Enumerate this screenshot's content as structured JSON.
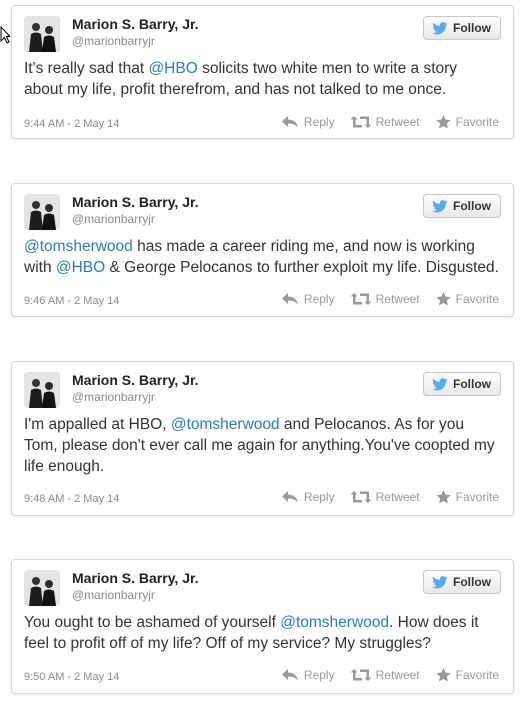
{
  "tweets": [
    {
      "name": "Marion S. Barry, Jr.",
      "handle": "@marionbarryjr",
      "follow_label": "Follow",
      "text": [
        {
          "t": "It's really sad that "
        },
        {
          "t": "@HBO",
          "mention": true
        },
        {
          "t": " solicits two white men to write a story about my life, profit therefrom, and has not talked to me once."
        }
      ],
      "time": "9:44 AM - 2 May 14",
      "reply_label": "Reply",
      "retweet_label": "Retweet",
      "favorite_label": "Favorite"
    },
    {
      "name": "Marion S. Barry, Jr.",
      "handle": "@marionbarryjr",
      "follow_label": "Follow",
      "text": [
        {
          "t": "@tomsherwood",
          "mention": true
        },
        {
          "t": " has made a career riding me, and now is working with "
        },
        {
          "t": "@HBO",
          "mention": true
        },
        {
          "t": " & George Pelocanos to further exploit my life. Disgusted."
        }
      ],
      "time": "9:46 AM - 2 May 14",
      "reply_label": "Reply",
      "retweet_label": "Retweet",
      "favorite_label": "Favorite"
    },
    {
      "name": "Marion S. Barry, Jr.",
      "handle": "@marionbarryjr",
      "follow_label": "Follow",
      "text": [
        {
          "t": "I'm appalled at HBO, "
        },
        {
          "t": "@tomsherwood",
          "mention": true
        },
        {
          "t": " and Pelocanos. As for you Tom, please don't ever call me again for anything.You've coopted my life enough."
        }
      ],
      "time": "9:48 AM - 2 May 14",
      "reply_label": "Reply",
      "retweet_label": "Retweet",
      "favorite_label": "Favorite"
    },
    {
      "name": "Marion S. Barry, Jr.",
      "handle": "@marionbarryjr",
      "follow_label": "Follow",
      "text": [
        {
          "t": "You ought to be ashamed of yourself "
        },
        {
          "t": "@tomsherwood",
          "mention": true
        },
        {
          "t": ". How does it feel to profit off of my life? Off of my service? My struggles?"
        }
      ],
      "time": "9:50 AM - 2 May 14",
      "reply_label": "Reply",
      "retweet_label": "Retweet",
      "favorite_label": "Favorite"
    }
  ],
  "colors": {
    "mention": "#2b7bb9",
    "bird": "#55acee",
    "border": "#d6d6d6",
    "muted": "#8a8a8a"
  },
  "icons": [
    "twitter-bird-icon",
    "reply-icon",
    "retweet-icon",
    "favorite-star-icon",
    "mouse-cursor-icon"
  ]
}
